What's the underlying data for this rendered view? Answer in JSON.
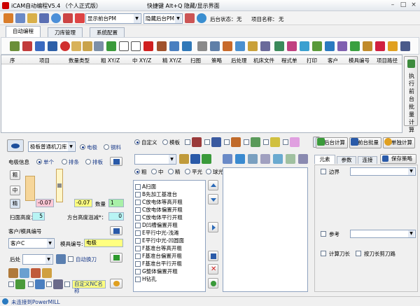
{
  "window": {
    "title": "iCAM自动编程V5.4 （个人正式版）",
    "hotkey_hint": "快捷键 Alt+Q 隐藏/显示界面"
  },
  "toolbar1": {
    "show_frontend_pm": "显示前台PM",
    "hide_backend_pm": "隐藏后台PM",
    "backend_status_label": "后台状态：",
    "backend_status_value": "无",
    "project_name_label": "项目名称：",
    "project_name_value": "无"
  },
  "tabs": [
    {
      "label": "自动编程"
    },
    {
      "label": "刀库管理"
    },
    {
      "label": "系统配置"
    }
  ],
  "table": {
    "columns": [
      "序",
      "项目",
      "数量类型",
      "粗 XY/Z",
      "中 XY/Z",
      "精 XY/Z",
      "扫图",
      "策略",
      "后处理",
      "机床文件",
      "程式单",
      "打印",
      "客户",
      "模具编号",
      "项目路径"
    ]
  },
  "exec_button": {
    "label": "执行前台批量计算"
  },
  "left": {
    "tool_select": "极板普通机刀库",
    "electrode_radio": "电极",
    "steel_radio": "钢料",
    "electrode_info_label": "电极信息",
    "mode_single": "单个",
    "mode_row": "排条",
    "mode_plate": "排板",
    "btn_coarse": "粗",
    "btn_mid": "中",
    "btn_fine": "精",
    "spark_coarse": "-0.07",
    "spark_fine": "-0.07",
    "count_label": "数量",
    "count_value": "1",
    "scan_height_label": "扫面高度：",
    "scan_height_value": "5",
    "square_height_label": "方台高度溢减*：",
    "square_height_value": "0",
    "customer_group_label": "客户/模具编号",
    "customer_value": "客户C",
    "mold_no_label": "模具编号:",
    "mold_no_value": "电极",
    "post_label": "后处",
    "auto_tool_change": "自动换刀",
    "custom_nc_name": "自定义NC名称"
  },
  "middle": {
    "custom_radio": "自定义",
    "template_radio": "模板",
    "rough": "粗",
    "medium": "中",
    "fine": "精",
    "flat": "平光",
    "ball": "球光",
    "strategies": [
      "A扫面",
      "B先加工基准台",
      "C放电体等高开粗",
      "C放电体偏置开粗",
      "C放电体平行开粗",
      "D凹槽偏置开粗",
      "E平行中光-浅滩",
      "E平行中光-凹圆面",
      "F基准台等高开粗",
      "F基准台偏置开粗",
      "F基准台平行开粗",
      "G整体偏置开粗",
      "H钻孔"
    ]
  },
  "right": {
    "backend_calc": "后台计算",
    "frontend_batch": "前台批量",
    "single_calc": "单独计算",
    "tab_elements": "元素",
    "tab_params": "参数",
    "tab_connect": "连接",
    "save_strategy": "保存策略",
    "boundary": "边界",
    "reference": "参考",
    "calc_tool_length": "计算刀长",
    "cut_by_tool_length": "按刀长剪刀路"
  },
  "status": {
    "text": "未连接到PowerMILL"
  }
}
